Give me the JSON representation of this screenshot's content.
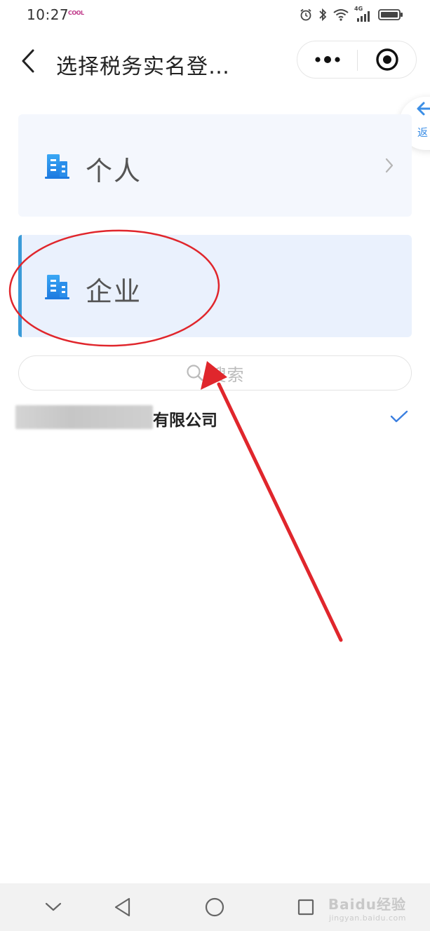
{
  "status_bar": {
    "time": "10:27",
    "app_logo_text": "COOL",
    "network_label": "4G"
  },
  "header": {
    "title": "选择税务实名登…",
    "more_icon": "more-dots-icon",
    "close_icon": "target-close-icon"
  },
  "side_tab": {
    "label": "返",
    "icon": "arrow-left-icon"
  },
  "options": [
    {
      "label": "个人",
      "icon": "building-icon",
      "selected": false
    },
    {
      "label": "企业",
      "icon": "building-icon",
      "selected": true
    }
  ],
  "search": {
    "placeholder": "搜索"
  },
  "company": {
    "name_suffix": "有限公司",
    "checked": true
  },
  "nav_bar": {
    "buttons": [
      "chevron-down-icon",
      "back-triangle-icon",
      "home-circle-icon",
      "recents-square-icon"
    ]
  },
  "watermark": {
    "main": "Baidu经验",
    "sub": "jingyan.baidu.com"
  },
  "colors": {
    "accent_blue": "#3a9bd8",
    "icon_blue": "#2f8ff0",
    "annotation_red": "#e0262c",
    "card_selected_bg": "#eaf1fd",
    "card_bg": "#f4f7fd"
  }
}
